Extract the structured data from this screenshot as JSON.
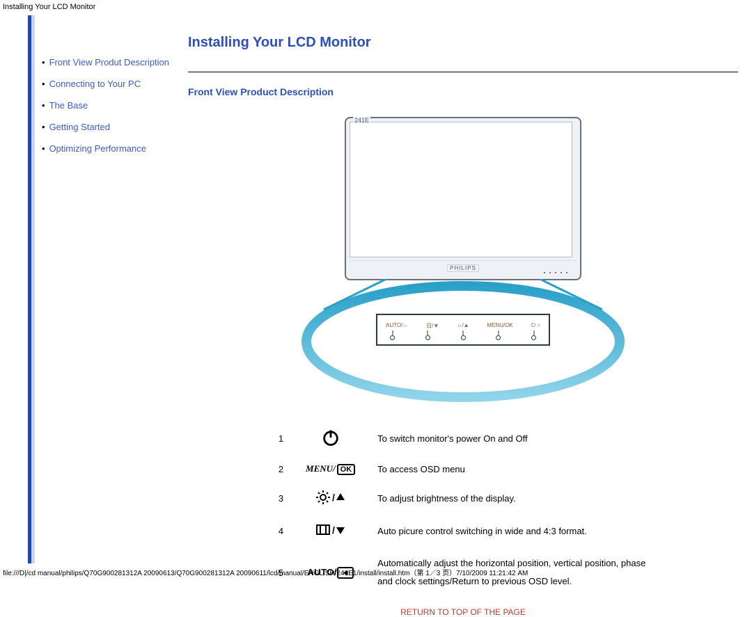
{
  "header": {
    "tab_title": "Installing Your LCD Monitor"
  },
  "sidebar": {
    "items": [
      {
        "label": "Front View Produt Description"
      },
      {
        "label": "Connecting to Your PC"
      },
      {
        "label": "The Base"
      },
      {
        "label": "Getting Started"
      },
      {
        "label": "Optimizing Performance"
      }
    ]
  },
  "main": {
    "title": "Installing Your LCD Monitor",
    "section_heading": "Front View Product Description",
    "monitor_model": "241E",
    "monitor_brand": "PHILIPS",
    "panel_labels": [
      "AUTO/←",
      "日/▼",
      "☼/▲",
      "MENU/OK",
      "⏻  ○"
    ],
    "rows": [
      {
        "num": "1",
        "desc": "To switch monitor's power On and Off"
      },
      {
        "num": "2",
        "desc": "To access OSD menu",
        "menu_text": "MENU/",
        "ok_text": "OK"
      },
      {
        "num": "3",
        "desc": "To adjust brightness of the display."
      },
      {
        "num": "4",
        "desc": "Auto picure control switching in wide and 4:3 format."
      },
      {
        "num": "5",
        "desc": "Automatically adjust the horizontal position, vertical position, phase    and clock settings/Return to previous OSD level.",
        "auto_text": "AUTO/",
        "back_text": "◄"
      }
    ],
    "return_link": "RETURN TO TOP OF THE PAGE"
  },
  "footer": {
    "text": "file:///D|/cd manual/philips/Q70G900281312A 20090613/Q70G900281312A 20090611/lcd/manual/ENGLISH/241E1/install/install.htm（第 1／3 页）7/10/2009 11:21:42 AM"
  }
}
